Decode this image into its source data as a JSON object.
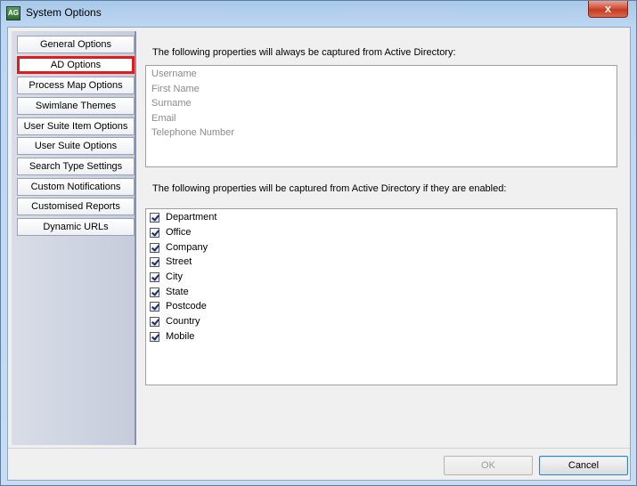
{
  "window": {
    "title": "System Options",
    "app_icon_text": "AG",
    "close_label": "x"
  },
  "sidebar": {
    "items": [
      {
        "label": "General Options"
      },
      {
        "label": "AD Options"
      },
      {
        "label": "Process Map Options"
      },
      {
        "label": "Swimlane Themes"
      },
      {
        "label": "User Suite Item Options"
      },
      {
        "label": "User Suite Options"
      },
      {
        "label": "Search Type Settings"
      },
      {
        "label": "Custom Notifications"
      },
      {
        "label": "Customised Reports"
      },
      {
        "label": "Dynamic URLs"
      }
    ],
    "selected": "AD Options",
    "selected_outline_color": "#e21b1b"
  },
  "main": {
    "always_heading": "The following properties will always be captured from Active Directory:",
    "always_items": [
      "Username",
      "First Name",
      "Surname",
      "Email",
      "Telephone Number"
    ],
    "optional_heading": "The following properties will be captured from Active Directory if they are enabled:",
    "optional_items": [
      {
        "label": "Department",
        "checked": true
      },
      {
        "label": "Office",
        "checked": true
      },
      {
        "label": "Company",
        "checked": true
      },
      {
        "label": "Street",
        "checked": true
      },
      {
        "label": "City",
        "checked": true
      },
      {
        "label": "State",
        "checked": true
      },
      {
        "label": "Postcode",
        "checked": true
      },
      {
        "label": "Country",
        "checked": true
      },
      {
        "label": "Mobile",
        "checked": true
      }
    ]
  },
  "footer": {
    "ok_label": "OK",
    "ok_enabled": false,
    "cancel_label": "Cancel"
  }
}
